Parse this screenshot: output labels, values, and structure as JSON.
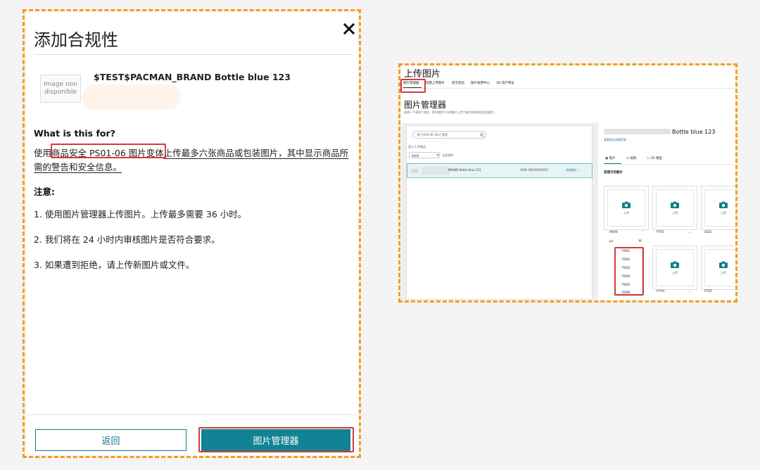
{
  "modal": {
    "title": "添加合规性",
    "product": {
      "image_placeholder": "Image non disponible",
      "name": "$TEST$PACMAN_BRAND Bottle blue 123"
    },
    "what_heading": "What is this for?",
    "description": {
      "before": "使用",
      "highlight": "商品安全 PS01-06 图片变体",
      "after": "上传最多六张商品或包装图片，其中显示商品所需的警告和安全信息。"
    },
    "note_heading": "注意:",
    "notes": [
      "1. 使用图片管理器上传图片。上传最多需要 36 小时。",
      "2. 我们将在 24 小时内审核图片是否符合要求。",
      "3. 如果遭到拒绝，请上传新图片或文件。"
    ],
    "back_label": "返回",
    "manager_label": "图片管理器"
  },
  "screenshot": {
    "title": "上传图片",
    "tabs": [
      "图片管理器",
      "批量上传图片",
      "提交状态",
      "图片收费中心",
      "3D 资产预览"
    ],
    "manager_title": "图片管理器",
    "manager_subtitle": "选择一个或多个商品，然后使用下方的图片上传工具为所选商品添加图片。",
    "search_placeholder": "按 ASIN 或 SKU 搜索",
    "filter_label": "显示 1 件商品",
    "filter_chip": "0000",
    "clear_filter": "全部清除",
    "row": {
      "name": "BRAND Bottle blue 123",
      "asin": "ASIN: B0000000PS3",
      "action": "添加图片"
    },
    "detail": {
      "name": "Bottle blue 123",
      "link": "查看商品详情页面",
      "tabs": [
        "图片",
        "视频",
        "3D 模型"
      ],
      "submitted_label": "您提交的图片",
      "upload_label": "上传",
      "slot_labels": [
        "MAIN",
        "PT01",
        "SIDE",
        "PT04",
        "PT05"
      ],
      "ps_input": "ps",
      "ps_options": [
        "PS01",
        "PS02",
        "PS03",
        "PS04",
        "PS05",
        "PS06"
      ]
    }
  },
  "colors": {
    "accent": "#128394",
    "highlight_border": "#d63a3a",
    "dashed_border": "#f0a020"
  }
}
